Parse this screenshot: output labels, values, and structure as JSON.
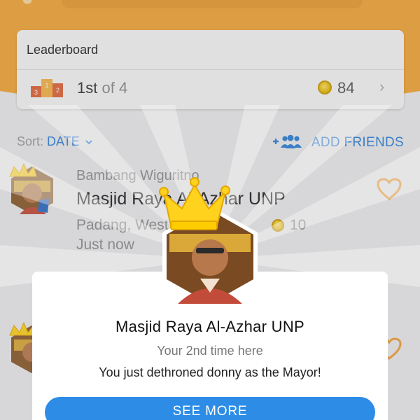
{
  "leaderboard": {
    "title": "Leaderboard",
    "rank": "1st",
    "rank_of": "of 4",
    "coins": "84",
    "podium_labels": [
      "3",
      "1",
      "2"
    ]
  },
  "sort": {
    "label": "Sort:",
    "value": "DATE"
  },
  "add_friends_label": "ADD FRIENDS",
  "feed": [
    {
      "user": "Bambang Wiguritno",
      "venue": "Masjid Raya Al-Azhar UNP",
      "location": "Padang, West Sumatra",
      "coins": "10",
      "time": "Just now"
    }
  ],
  "modal": {
    "venue": "Masjid Raya Al-Azhar UNP",
    "visit_count": "Your 2nd time here",
    "mayor_text": "You just dethroned donny as the Mayor!",
    "button": "SEE MORE"
  },
  "colors": {
    "header_orange": "#f3a637",
    "accent_blue": "#2d7fd8",
    "heart_orange": "#f0a03a",
    "crown_yellow": "#ffd21e"
  }
}
